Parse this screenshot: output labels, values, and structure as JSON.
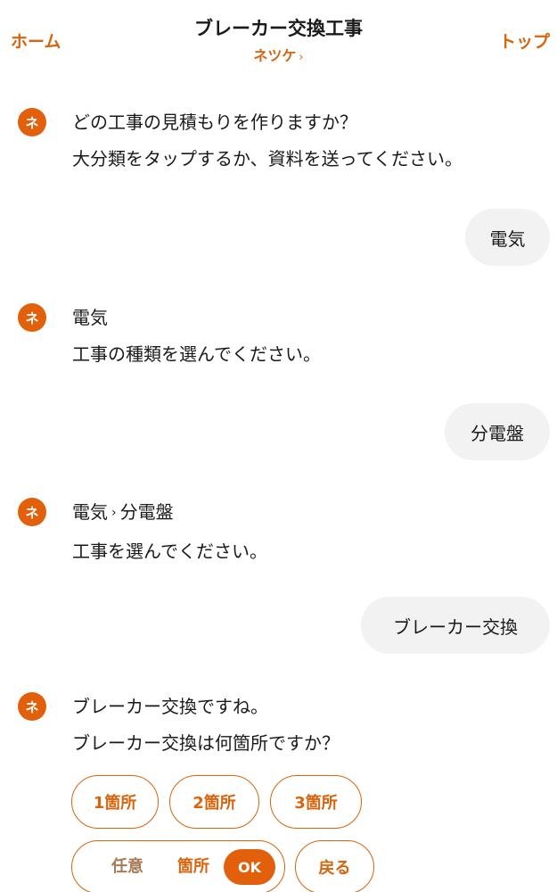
{
  "header": {
    "home_label": "ホーム",
    "title": "ブレーカー交換工事",
    "subtitle": "ネツケ",
    "subtitle_chevron": "›",
    "top_label": "トップ"
  },
  "chat": {
    "avatar_label": "ネ",
    "bot_1": {
      "line1": "どの工事の見積もりを作りますか？",
      "line2": "大分類をタップするか、資料を送ってください。"
    },
    "user_1": "電気",
    "bot_2": {
      "line1": "電気",
      "line2": "工事の種類を選んでください。"
    },
    "user_2": "分電盤",
    "bot_3": {
      "crumb1": "電気",
      "sep": "›",
      "crumb2": "分電盤",
      "line2": "工事を選んでください。"
    },
    "user_3": "ブレーカー交換",
    "bot_4": {
      "line1": "ブレーカー交換ですね。",
      "line2": "ブレーカー交換は何箇所ですか？"
    }
  },
  "options": {
    "one": "1箇所",
    "two": "2箇所",
    "three": "3箇所",
    "custom_placeholder": "任意",
    "custom_unit": "箇所",
    "ok_label": "OK",
    "back_label": "戻る"
  },
  "colors": {
    "accent": "#d9640c",
    "avatar_bg": "#e2600b",
    "user_bubble": "#f2f2f2"
  }
}
